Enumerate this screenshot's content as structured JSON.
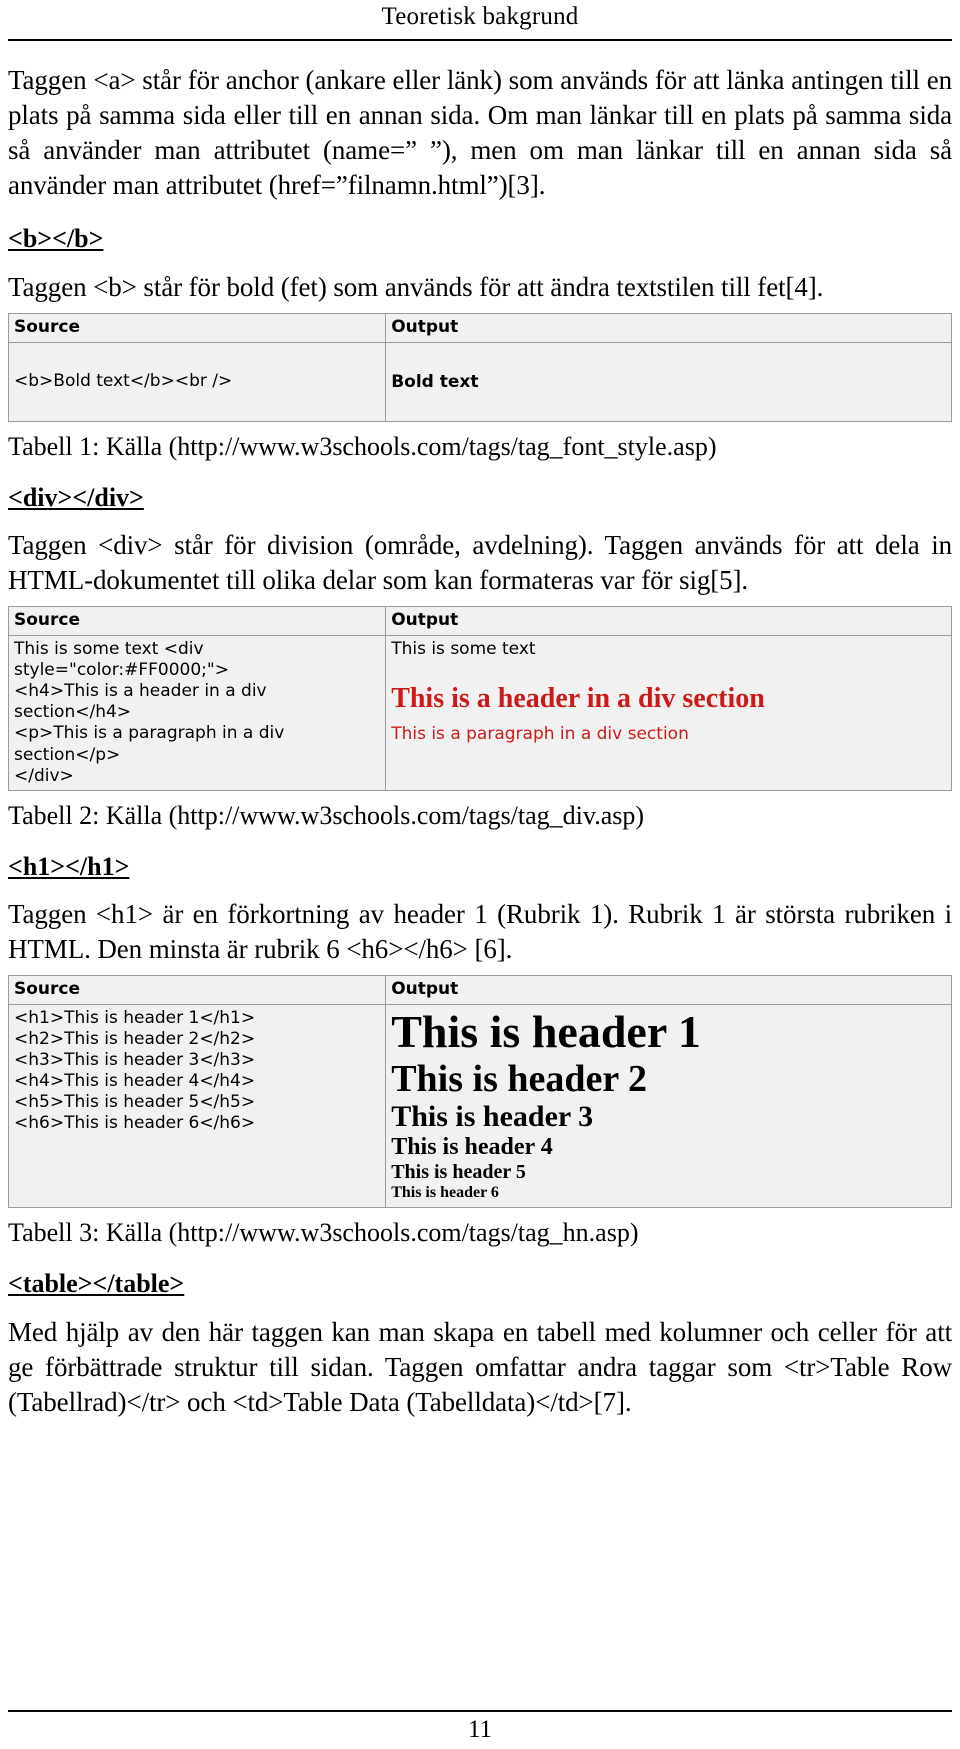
{
  "document": {
    "running_header": "Teoretisk bakgrund",
    "page_number": "11"
  },
  "sections": {
    "anchor": {
      "paragraph": "Taggen <a> står för anchor (ankare eller länk) som används för att länka antingen till en plats på samma sida eller till en annan sida. Om man länkar till en plats på samma sida så använder man attributet (name=” ”), men om man länkar till en annan sida så använder man attributet (href=”filnamn.html”)[3]."
    },
    "bold": {
      "heading": "<b></b>",
      "paragraph": "Taggen <b> står för bold (fet) som används för att ändra textstilen till fet[4].",
      "table": {
        "headers": [
          "Source",
          "Output"
        ],
        "source": "<b>Bold text</b><br />",
        "output_bold_text": "Bold text"
      },
      "caption": "Tabell 1: Källa (http://www.w3schools.com/tags/tag_font_style.asp)"
    },
    "div": {
      "heading": "<div></div>",
      "paragraph": "Taggen <div> står för division (område, avdelning). Taggen används för att dela in HTML-dokumentet till olika delar som kan formateras var för sig[5].",
      "table": {
        "headers": [
          "Source",
          "Output"
        ],
        "source": "This is some text <div style=\"color:#FF0000;\">\n<h4>This is a header in a div section</h4>\n<p>This is a paragraph in a div section</p>\n</div>",
        "output_plain": "This is some text",
        "output_header": "This is a header in a div section",
        "output_paragraph": "This is a paragraph in a div section",
        "output_color": "#FF0000"
      },
      "caption": "Tabell 2: Källa (http://www.w3schools.com/tags/tag_div.asp)"
    },
    "h1": {
      "heading": "<h1></h1>",
      "paragraph": "Taggen <h1> är en förkortning av header 1 (Rubrik 1). Rubrik 1 är största rubriken i HTML. Den minsta är rubrik 6 <h6></h6> [6].",
      "table": {
        "headers": [
          "Source",
          "Output"
        ],
        "source": "<h1>This is header 1</h1>\n<h2>This is header 2</h2>\n<h3>This is header 3</h3>\n<h4>This is header 4</h4>\n<h5>This is header 5</h5>\n<h6>This is header 6</h6>",
        "outputs": [
          "This is header 1",
          "This is header 2",
          "This is header 3",
          "This is header 4",
          "This is header 5",
          "This is header 6"
        ]
      },
      "caption": "Tabell 3: Källa (http://www.w3schools.com/tags/tag_hn.asp)"
    },
    "table": {
      "heading": "<table></table>",
      "paragraph": "Med hjälp av den här taggen kan man skapa en tabell med kolumner och celler för att ge förbättrade struktur till sidan. Taggen omfattar andra taggar som <tr>Table Row (Tabellrad)</tr> och <td>Table Data (Tabelldata)</td>[7]."
    }
  }
}
